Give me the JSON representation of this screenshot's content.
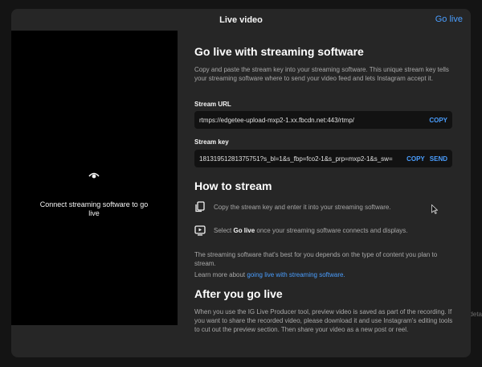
{
  "header": {
    "title": "Live video",
    "go_live_label": "Go live"
  },
  "preview": {
    "icon": "eye-icon",
    "message": "Connect streaming software to go live"
  },
  "streaming_software": {
    "heading": "Go live with streaming software",
    "description": "Copy and paste the stream key into your streaming software. This unique stream key tells your streaming software where to send your video feed and lets Instagram accept it.",
    "stream_url": {
      "label": "Stream URL",
      "value": "rtmps://edgetee-upload-mxp2-1.xx.fbcdn.net:443/rtmp/",
      "copy_label": "COPY"
    },
    "stream_key": {
      "label": "Stream key",
      "value": "18131951281375751?s_bl=1&s_fbp=fco2-1&s_prp=mxp2-1&s_sw=",
      "copy_label": "COPY",
      "send_label": "SEND"
    }
  },
  "how_to": {
    "heading": "How to stream",
    "step1": "Copy the stream key and enter it into your streaming software.",
    "step2_pre": "Select",
    "step2_bold": "Go live",
    "step2_post": "once your streaming software connects and displays.",
    "note": "The streaming software that's best for you depends on the type of content you plan to stream.",
    "learn_prefix": "Learn more about",
    "learn_link": "going live with streaming software."
  },
  "after": {
    "heading": "After you go live",
    "text": "When you use the IG Live Producer tool, preview video is saved as part of the recording. If you want to share the recorded video, please download it and use Instagram's editing tools to cut out the preview section. Then share your video as a new post or reel."
  },
  "backdrop": {
    "right_fragment": "deta"
  },
  "colors": {
    "accent": "#4a9eff",
    "modal_bg": "#262626",
    "field_bg": "#121212",
    "preview_bg": "#000000"
  }
}
